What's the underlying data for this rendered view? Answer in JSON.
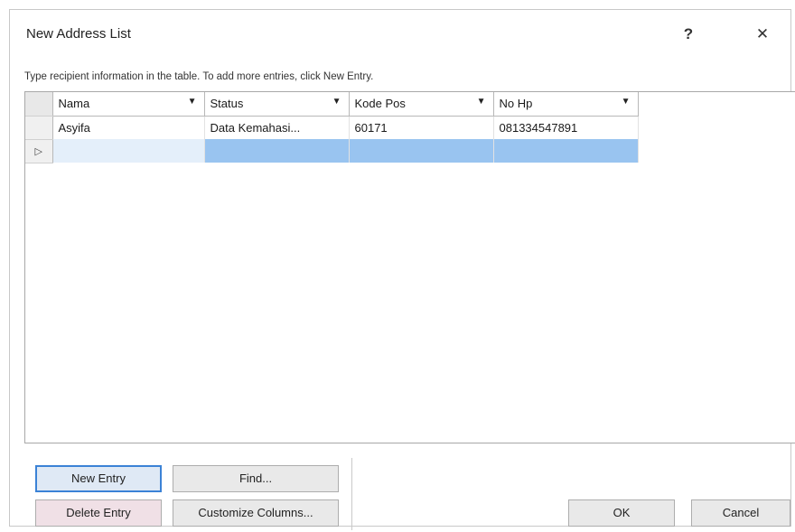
{
  "dialog": {
    "title": "New Address List",
    "help_label": "?",
    "close_label": "✕",
    "instruction": "Type recipient information in the table. To add more entries, click New Entry."
  },
  "table": {
    "columns": [
      "Nama",
      "Status",
      "Kode Pos",
      "No Hp"
    ],
    "rows": [
      [
        "Asyifa",
        "Data Kemahasi...",
        "60171",
        "081334547891"
      ],
      [
        "",
        "",
        "",
        ""
      ]
    ],
    "current_row_pointer": "▷"
  },
  "buttons": {
    "new_entry": "New Entry",
    "find": "Find...",
    "delete_entry": "Delete Entry",
    "customize_columns": "Customize Columns...",
    "ok": "OK",
    "cancel": "Cancel"
  }
}
